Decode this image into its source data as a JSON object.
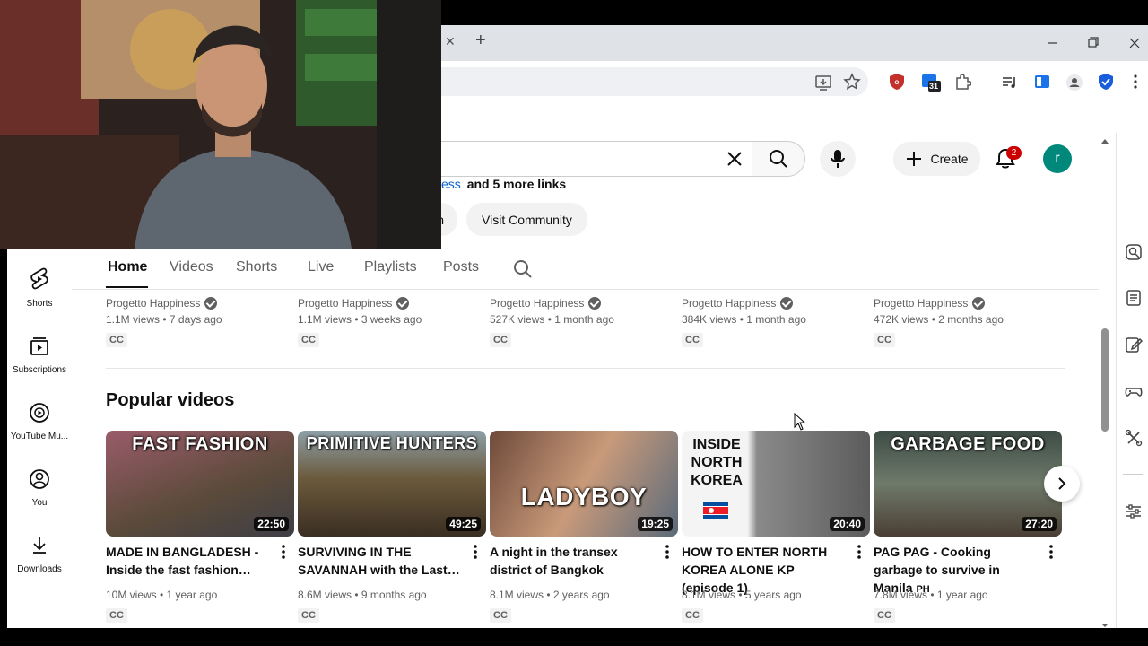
{
  "browser": {
    "new_tab_symbol": "+",
    "tab_close_symbol": "✕",
    "window_controls": [
      "minimize-icon",
      "restore-icon",
      "close-icon"
    ],
    "calendar_badge": "31"
  },
  "masthead": {
    "create_label": "Create",
    "notification_count": "2",
    "avatar_letter": "r",
    "avatar_color": "#00897b"
  },
  "channel": {
    "links_fragment": "ess",
    "links_more": "and 5 more links",
    "partial_pill": "n",
    "visit_community": "Visit Community"
  },
  "tabs": [
    "Home",
    "Videos",
    "Shorts",
    "Live",
    "Playlists",
    "Posts"
  ],
  "sidebar": [
    {
      "label": "Shorts",
      "icon": "shorts-icon"
    },
    {
      "label": "Subscriptions",
      "icon": "subscriptions-icon"
    },
    {
      "label": "YouTube Mu...",
      "icon": "youtube-music-icon"
    },
    {
      "label": "You",
      "icon": "you-icon"
    },
    {
      "label": "Downloads",
      "icon": "downloads-icon"
    }
  ],
  "prev_row": [
    {
      "channel": "Progetto Happiness",
      "stats": "1.1M views • 7 days ago",
      "cc": "CC"
    },
    {
      "channel": "Progetto Happiness",
      "stats": "1.1M views • 3 weeks ago",
      "cc": "CC"
    },
    {
      "channel": "Progetto Happiness",
      "stats": "527K views • 1 month ago",
      "cc": "CC"
    },
    {
      "channel": "Progetto Happiness",
      "stats": "384K views • 1 month ago",
      "cc": "CC"
    },
    {
      "channel": "Progetto Happiness",
      "stats": "472K views • 2 months ago",
      "cc": "CC"
    }
  ],
  "popular": {
    "heading": "Popular videos",
    "videos": [
      {
        "thumb_text": "FAST FASHION",
        "duration": "22:50",
        "title": "MADE IN BANGLADESH - Inside the fast fashion…",
        "stats": "10M views • 1 year ago",
        "cc": "CC",
        "color": "#7a4a55"
      },
      {
        "thumb_text": "PRIMITIVE HUNTERS",
        "duration": "49:25",
        "title": "SURVIVING IN THE SAVANNAH with the Last…",
        "stats": "8.6M views • 9 months ago",
        "cc": "CC",
        "color": "#6b5a3c"
      },
      {
        "thumb_text": "LADYBOY",
        "duration": "19:25",
        "title": "A night in the transex district of Bangkok",
        "stats": "8.1M views • 2 years ago",
        "cc": "CC",
        "color": "#8a6a58"
      },
      {
        "thumb_text": "INSIDE NORTH KOREA",
        "duration": "20:40",
        "title": "HOW TO ENTER NORTH KOREA ALONE",
        "title_suffix": "KP (episode 1)",
        "stats": "8.1M views • 5 years ago",
        "cc": "CC",
        "color": "#b8b8b8"
      },
      {
        "thumb_text": "GARBAGE FOOD",
        "duration": "27:20",
        "title": "PAG PAG - Cooking garbage to survive in Manila",
        "title_suffix": "PH",
        "stats": "7.8M views • 1 year ago",
        "cc": "CC",
        "color": "#4f6258"
      }
    ]
  }
}
